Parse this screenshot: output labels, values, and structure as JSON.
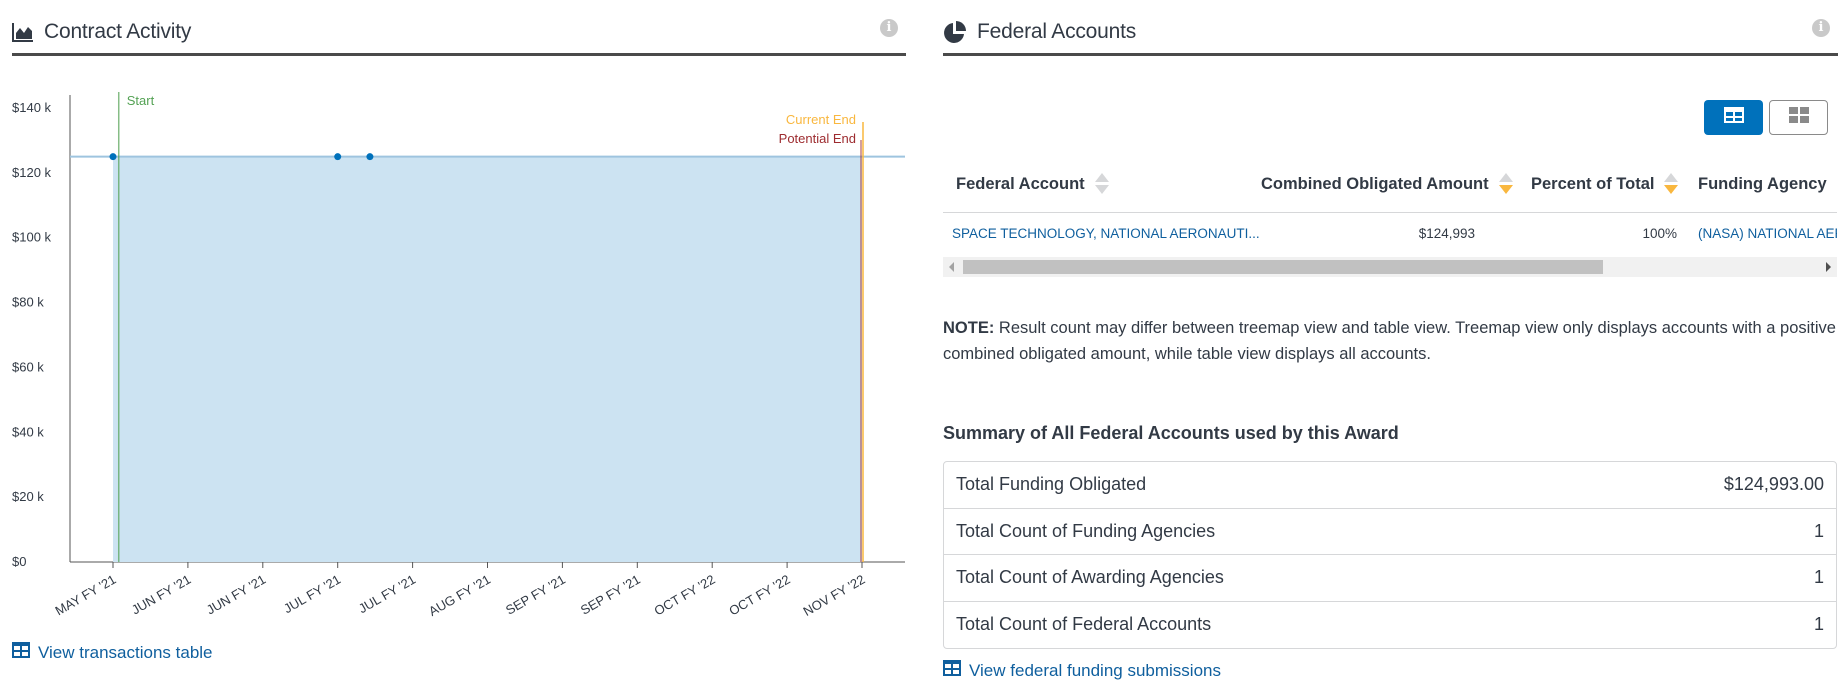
{
  "contract_activity": {
    "title": "Contract Activity",
    "icon": "area-chart-icon",
    "info_icon": "i",
    "view_transactions_label": "View transactions table",
    "chart_data": {
      "type": "area",
      "y_ticks": [
        "$0",
        "$20 k",
        "$40 k",
        "$60 k",
        "$80 k",
        "$100 k",
        "$120 k",
        "$140 k"
      ],
      "y_tick_values": [
        0,
        20000,
        40000,
        60000,
        80000,
        100000,
        120000,
        140000
      ],
      "ylim": [
        0,
        140000
      ],
      "x_ticks": [
        "MAY FY '21",
        "JUN FY '21",
        "JUN FY '21",
        "JUL FY '21",
        "JUL FY '21",
        "AUG FY '21",
        "SEP FY '21",
        "SEP FY '21",
        "OCT FY '22",
        "OCT FY '22",
        "NOV FY '22"
      ],
      "points": [
        {
          "x": 0.0,
          "y": 124993
        },
        {
          "x": 3.0,
          "y": 124993
        },
        {
          "x": 3.43,
          "y": 124993
        }
      ],
      "area_end_x": 10.0,
      "area_value": 124993,
      "markers": {
        "start_label": "Start",
        "start_x": 0.05,
        "current_end_label": "Current End",
        "potential_end_label": "Potential End",
        "end_x": 10.0
      },
      "colors": {
        "area_fill": "#cce3f2",
        "line": "#9ec4df",
        "point": "#0071bb",
        "start": "#54a254",
        "current_end": "#f9b73e",
        "potential_end": "#9d2b2f"
      }
    }
  },
  "federal_accounts": {
    "title": "Federal Accounts",
    "icon": "pie-chart-icon",
    "info_icon": "i",
    "toggles": {
      "table_icon": "table-view-icon",
      "tree_icon": "treemap-view-icon"
    },
    "columns": [
      "Federal Account",
      "Combined Obligated Amount",
      "Percent of Total",
      "Funding Agency"
    ],
    "rows": [
      {
        "account": "SPACE TECHNOLOGY, NATIONAL AERONAUTI...",
        "amount": "$124,993",
        "percent": "100%",
        "agency": "(NASA) NATIONAL AERONAUTICS AND SPACE ADMINISTRATION"
      }
    ],
    "note_label": "NOTE:",
    "note_text": " Result count may differ between treemap view and table view. Treemap view only displays accounts with a positive combined obligated amount, while table view displays all accounts.",
    "summary_title": "Summary of All Federal Accounts used by this Award",
    "summary": [
      {
        "label": "Total Funding Obligated",
        "value": "$124,993.00"
      },
      {
        "label": "Total Count of Funding Agencies",
        "value": "1"
      },
      {
        "label": "Total Count of Awarding Agencies",
        "value": "1"
      },
      {
        "label": "Total Count of Federal Accounts",
        "value": "1"
      }
    ],
    "view_submissions_label": "View federal funding submissions"
  }
}
